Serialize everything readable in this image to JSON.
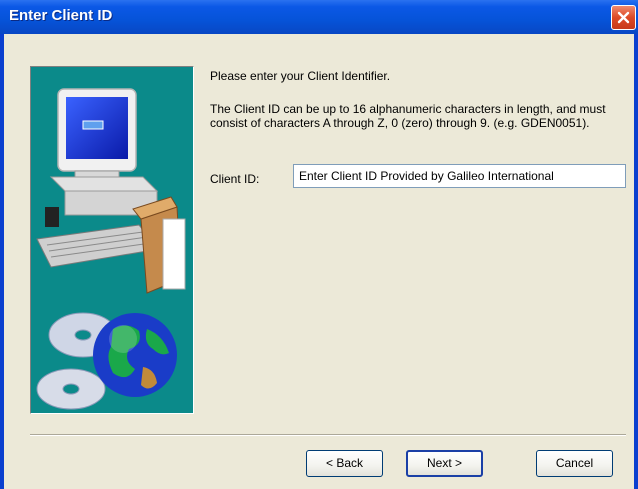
{
  "window": {
    "title": "Enter Client ID",
    "close_icon": "close-icon"
  },
  "content": {
    "intro": "Please enter your Client Identifier.",
    "detail": "The Client ID can be up to 16 alphanumeric characters in length, and must consist of characters A through Z, 0 (zero) through 9. (e.g. GDEN0051).",
    "client_id_label": "Client ID:",
    "client_id_value": "Enter Client ID Provided by Galileo International"
  },
  "buttons": {
    "back": "< Back",
    "next": "Next >",
    "cancel": "Cancel"
  },
  "illustration": {
    "icons": [
      "computer-icon",
      "cd-disc-icon",
      "globe-icon"
    ],
    "background_color": "#0b8a8a"
  },
  "colors": {
    "titlebar": "#0653d8",
    "dialog_bg": "#ece9d8",
    "close_button": "#dd4a26"
  }
}
